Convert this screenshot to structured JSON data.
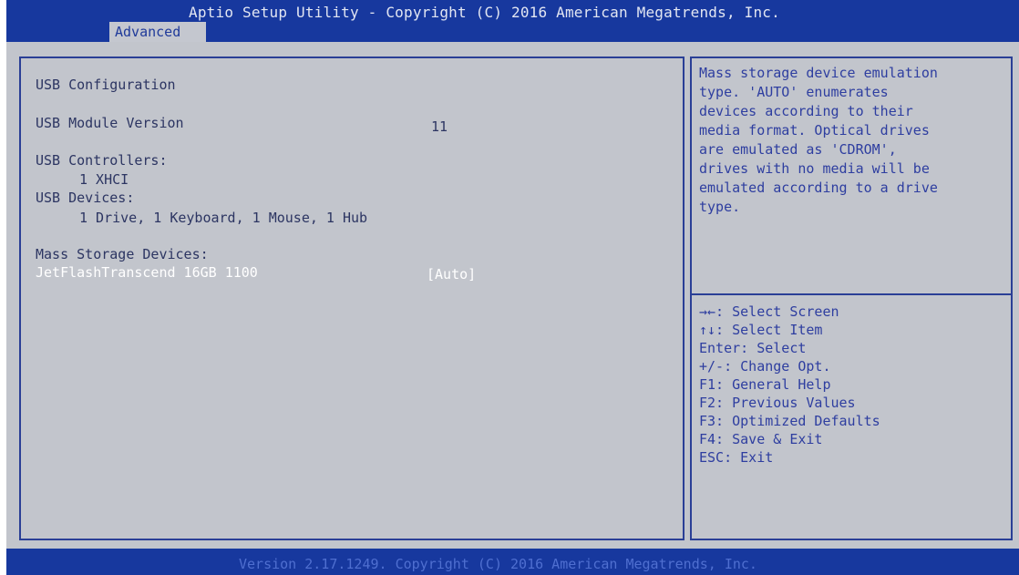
{
  "header": {
    "title": "Aptio Setup Utility - Copyright (C) 2016 American Megatrends, Inc.",
    "tab": "Advanced"
  },
  "main": {
    "section_title": "USB Configuration",
    "module_version_label": "USB Module Version",
    "module_version_value": "11",
    "controllers_label": "USB Controllers:",
    "controllers_value": "1 XHCI",
    "devices_label": "USB Devices:",
    "devices_value": "1 Drive, 1 Keyboard, 1 Mouse, 1 Hub",
    "mass_storage_label": "Mass Storage Devices:",
    "mass_storage_device": "JetFlashTranscend 16GB 1100",
    "mass_storage_option": "[Auto]"
  },
  "help": {
    "lines": [
      "Mass storage device emulation",
      "type. 'AUTO' enumerates",
      "devices according to their",
      "media format. Optical drives",
      "are emulated as 'CDROM',",
      "drives with no media will be",
      "emulated according to a drive",
      "type."
    ]
  },
  "keys": [
    "→←: Select Screen",
    "↑↓: Select Item",
    "Enter: Select",
    "+/-: Change Opt.",
    "F1: General Help",
    "F2: Previous Values",
    "F3: Optimized Defaults",
    "F4: Save & Exit",
    "ESC: Exit"
  ],
  "footer": {
    "text": "Version 2.17.1249. Copyright (C) 2016 American Megatrends, Inc."
  },
  "colors": {
    "header_bg": "#17389e",
    "panel_bg": "#c2c5cc",
    "border": "#2a3f96",
    "text": "#2c3562",
    "help_text": "#2e3ea0",
    "selected_text": "#ffffff"
  }
}
